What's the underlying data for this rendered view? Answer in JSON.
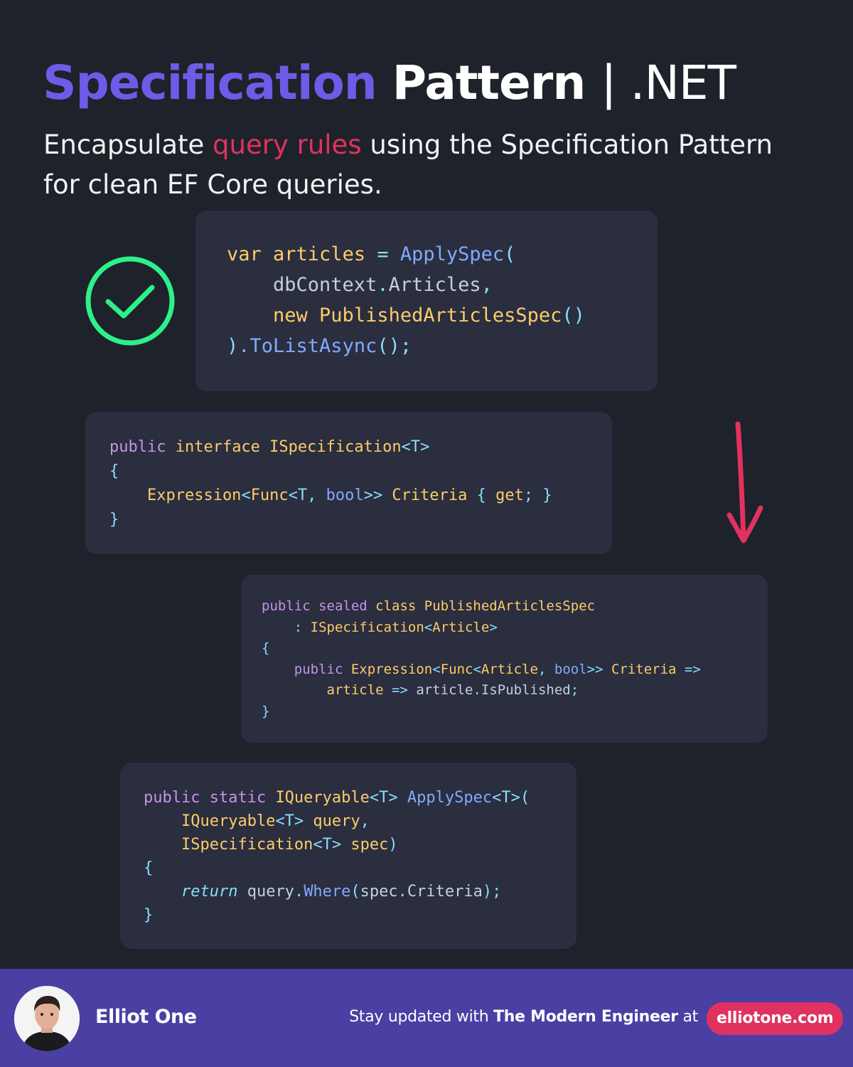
{
  "title": {
    "part1": "Specification",
    "part2": "Pattern",
    "part3": "| .NET"
  },
  "subtitle": {
    "pre": "Encapsulate ",
    "highlight": "query rules",
    "post": " using the Specification Pattern for clean EF Core queries."
  },
  "icons": {
    "check": "check-circle-icon",
    "arrow": "down-arrow-icon",
    "avatar": "avatar-photo"
  },
  "colors": {
    "background": "#1e222a",
    "accent": "#6c5ce7",
    "highlight": "#e0325e",
    "check": "#2ef08a",
    "footer": "#4a3fa3",
    "card": "#2a2e3e"
  },
  "code": {
    "usage": [
      [
        [
          "var ",
          "y"
        ],
        [
          "articles ",
          "y"
        ],
        [
          "= ",
          "p"
        ],
        [
          "ApplySpec",
          "f"
        ],
        [
          "(",
          "p"
        ]
      ],
      [
        [
          "    dbContext",
          "b"
        ],
        [
          ".",
          "p"
        ],
        [
          "Articles",
          "b"
        ],
        [
          ",",
          "p"
        ]
      ],
      [
        [
          "    new ",
          "y"
        ],
        [
          "PublishedArticlesSpec",
          "y"
        ],
        [
          "()",
          "p"
        ]
      ],
      [
        [
          ")",
          "p"
        ],
        [
          ".ToListAsync",
          "f"
        ],
        [
          "();",
          "p"
        ]
      ]
    ],
    "interface": [
      [
        [
          "public ",
          "k"
        ],
        [
          "interface ",
          "y"
        ],
        [
          "ISpecification",
          "y"
        ],
        [
          "<T>",
          "p"
        ]
      ],
      [
        [
          "{",
          "p"
        ]
      ],
      [
        [
          "    Expression",
          "y"
        ],
        [
          "<",
          "p"
        ],
        [
          "Func",
          "y"
        ],
        [
          "<T, ",
          "p"
        ],
        [
          "bool",
          "f"
        ],
        [
          ">> ",
          "p"
        ],
        [
          "Criteria ",
          "y"
        ],
        [
          "{ ",
          "p"
        ],
        [
          "get",
          "y"
        ],
        [
          "; }",
          "p"
        ]
      ],
      [
        [
          "}",
          "p"
        ]
      ]
    ],
    "spec": [
      [
        [
          "public ",
          "k"
        ],
        [
          "sealed ",
          "k"
        ],
        [
          "class ",
          "y"
        ],
        [
          "PublishedArticlesSpec",
          "y"
        ]
      ],
      [
        [
          "    : ",
          "p"
        ],
        [
          "ISpecification",
          "y"
        ],
        [
          "<",
          "p"
        ],
        [
          "Article",
          "y"
        ],
        [
          ">",
          "p"
        ]
      ],
      [
        [
          "{",
          "p"
        ]
      ],
      [
        [
          "    public ",
          "k"
        ],
        [
          "Expression",
          "y"
        ],
        [
          "<",
          "p"
        ],
        [
          "Func",
          "y"
        ],
        [
          "<",
          "p"
        ],
        [
          "Article",
          "y"
        ],
        [
          ", ",
          "p"
        ],
        [
          "bool",
          "f"
        ],
        [
          ">> ",
          "p"
        ],
        [
          "Criteria ",
          "y"
        ],
        [
          "=>",
          "p"
        ]
      ],
      [
        [
          "        article ",
          "y"
        ],
        [
          "=> ",
          "p"
        ],
        [
          "article",
          "b"
        ],
        [
          ".",
          "p"
        ],
        [
          "IsPublished",
          "b"
        ],
        [
          ";",
          "p"
        ]
      ],
      [
        [
          "}",
          "p"
        ]
      ]
    ],
    "apply": [
      [
        [
          "public ",
          "k"
        ],
        [
          "static ",
          "k"
        ],
        [
          "IQueryable",
          "y"
        ],
        [
          "<T> ",
          "p"
        ],
        [
          "ApplySpec",
          "f"
        ],
        [
          "<T>(",
          "p"
        ]
      ],
      [
        [
          "    IQueryable",
          "y"
        ],
        [
          "<T> ",
          "p"
        ],
        [
          "query",
          "y"
        ],
        [
          ",",
          "p"
        ]
      ],
      [
        [
          "    ISpecification",
          "y"
        ],
        [
          "<T> ",
          "p"
        ],
        [
          "spec",
          "y"
        ],
        [
          ")",
          "p"
        ]
      ],
      [
        [
          "{",
          "p"
        ]
      ],
      [
        [
          "    return ",
          "i"
        ],
        [
          "query",
          "b"
        ],
        [
          ".",
          "p"
        ],
        [
          "Where",
          "f"
        ],
        [
          "(",
          "p"
        ],
        [
          "spec",
          "b"
        ],
        [
          ".",
          "p"
        ],
        [
          "Criteria",
          "b"
        ],
        [
          ");",
          "p"
        ]
      ],
      [
        [
          "}",
          "p"
        ]
      ]
    ]
  },
  "footer": {
    "author": "Elliot One",
    "cta_pre": "Stay updated with ",
    "cta_brand": "The Modern Engineer",
    "cta_post": " at",
    "site": "elliotone.com"
  }
}
